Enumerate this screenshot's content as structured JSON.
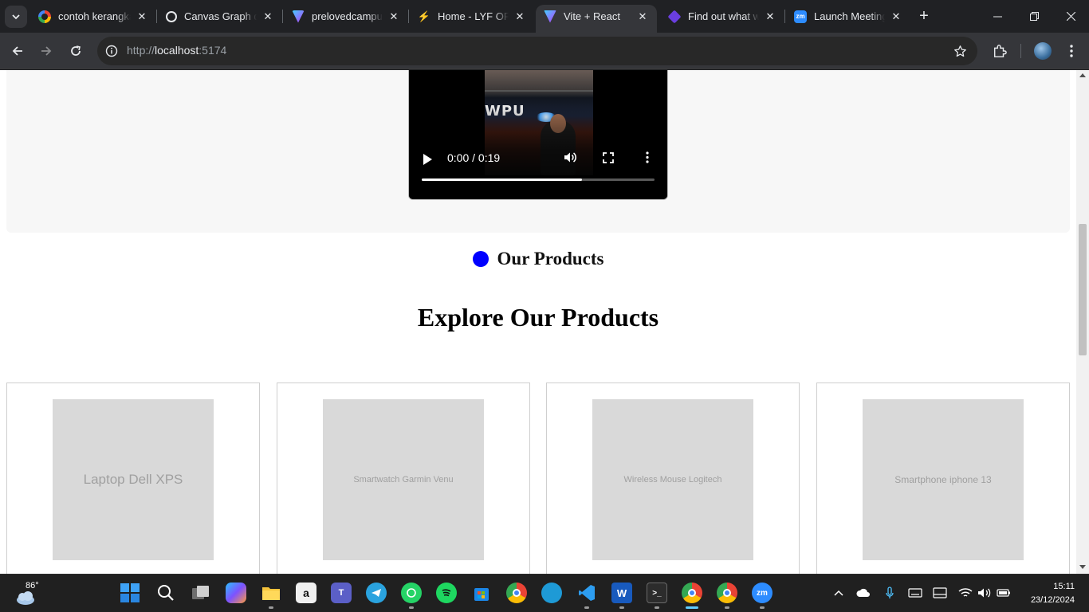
{
  "browser": {
    "tabs": [
      {
        "title": "contoh kerangka",
        "favicon": "google-icon"
      },
      {
        "title": "Canvas Graph dan",
        "favicon": "openai-icon"
      },
      {
        "title": "prelovedcampus",
        "favicon": "vite-icon"
      },
      {
        "title": "Home - LYF OFFICE",
        "favicon": "lyf-icon"
      },
      {
        "title": "Vite + React",
        "favicon": "vite-icon",
        "active": true
      },
      {
        "title": "Find out what we",
        "favicon": "purple-diamond-icon"
      },
      {
        "title": "Launch Meeting",
        "favicon": "zoom-icon"
      }
    ],
    "url_scheme": "http://",
    "url_host": "localhost",
    "url_port": ":5174"
  },
  "video": {
    "time": "0:00 / 0:19",
    "progress": 0.69,
    "overlay_text": "WPU"
  },
  "page": {
    "section_label": "Our Products",
    "heading": "Explore Our Products",
    "products": [
      {
        "name": "Laptop Dell XPS"
      },
      {
        "name": "Smartwatch Garmin Venu"
      },
      {
        "name": "Wireless Mouse Logitech"
      },
      {
        "name": "Smartphone iphone 13"
      }
    ]
  },
  "taskbar": {
    "temperature": "86°",
    "time": "15:11",
    "date": "23/12/2024",
    "zoom_label": "zm",
    "word_label": "W",
    "teams_label": "T"
  },
  "colors": {
    "accent_blue": "#0000ff",
    "browser_dark": "#202124",
    "toolbar": "#35363a",
    "placeholder_gray": "#d9d9d9"
  }
}
